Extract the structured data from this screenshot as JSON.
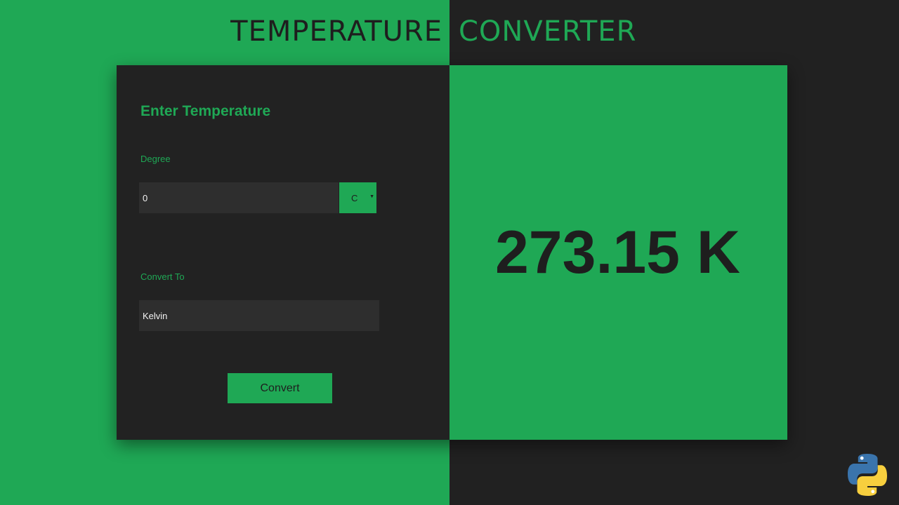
{
  "title": {
    "left_word": "TEMPERATURE",
    "right_word": "CONVERTER"
  },
  "form": {
    "heading": "Enter Temperature",
    "degree_label": "Degree",
    "degree_value": "0",
    "unit_value": "C",
    "convert_to_label": "Convert To",
    "convert_to_value": "Kelvin",
    "convert_button": "Convert"
  },
  "result": {
    "text": "273.15 K"
  },
  "icons": {
    "logo": "python-logo-icon",
    "dropdown": "chevron-down-icon"
  },
  "colors": {
    "accent_green": "#1fa855",
    "dark": "#222222",
    "input_bg": "#2e2e2e"
  }
}
